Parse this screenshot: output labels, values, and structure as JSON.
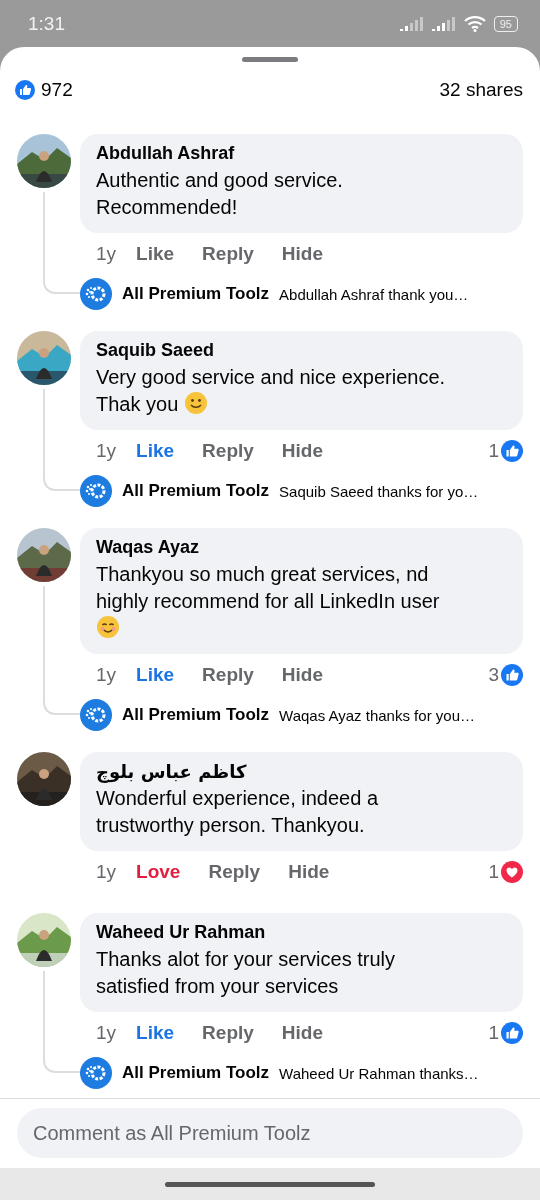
{
  "status_bar": {
    "time": "1:31",
    "battery": "95"
  },
  "summary": {
    "likes": "972",
    "shares": "32 shares"
  },
  "comments": [
    {
      "author": "Abdullah Ashraf",
      "text": "Authentic and good service.\nRecommended!",
      "time": "1y",
      "react": {
        "label": "Like",
        "selected": false
      },
      "reply_label": "Reply",
      "hide_label": "Hide",
      "reply": {
        "author": "All Premium Toolz",
        "text": "Abdullah Ashraf  thank you…"
      }
    },
    {
      "author": "Saquib Saeed",
      "text": "Very good service and nice experience.\nThak you ",
      "emoji": {
        "kind": "smile"
      },
      "time": "1y",
      "react": {
        "label": "Like",
        "kind": "like",
        "selected": true
      },
      "reply_label": "Reply",
      "hide_label": "Hide",
      "count": {
        "text": "1",
        "kind": "like"
      },
      "reply": {
        "author": "All Premium Toolz",
        "text": "Saquib Saeed thanks for yo…"
      }
    },
    {
      "author": "Waqas Ayaz",
      "text": "Thankyou so much great services, nd\nhighly recommend for all LinkedIn user\n",
      "emoji": {
        "kind": "blush"
      },
      "time": "1y",
      "react": {
        "label": "Like",
        "kind": "like",
        "selected": true
      },
      "reply_label": "Reply",
      "hide_label": "Hide",
      "count": {
        "text": "3",
        "kind": "like"
      },
      "reply": {
        "author": "All Premium Toolz",
        "text": "Waqas Ayaz thanks for you…"
      }
    },
    {
      "author": "كاظم عباس بلوچ",
      "text": "Wonderful experience, indeed a\ntrustworthy person. Thankyou.",
      "time": "1y",
      "react": {
        "label": "Love",
        "kind": "love",
        "selected": true
      },
      "reply_label": "Reply",
      "hide_label": "Hide",
      "count": {
        "text": "1",
        "kind": "love"
      }
    },
    {
      "author": "Waheed Ur Rahman",
      "text": "Thanks alot for your services truly\nsatisfied from your services",
      "time": "1y",
      "react": {
        "label": "Like",
        "kind": "like",
        "selected": true
      },
      "reply_label": "Reply",
      "hide_label": "Hide",
      "count": {
        "text": "1",
        "kind": "like"
      },
      "reply": {
        "author": "All Premium Toolz",
        "text": "Waheed Ur Rahman thanks…"
      }
    }
  ],
  "composer": {
    "placeholder": "Comment as All Premium Toolz"
  }
}
